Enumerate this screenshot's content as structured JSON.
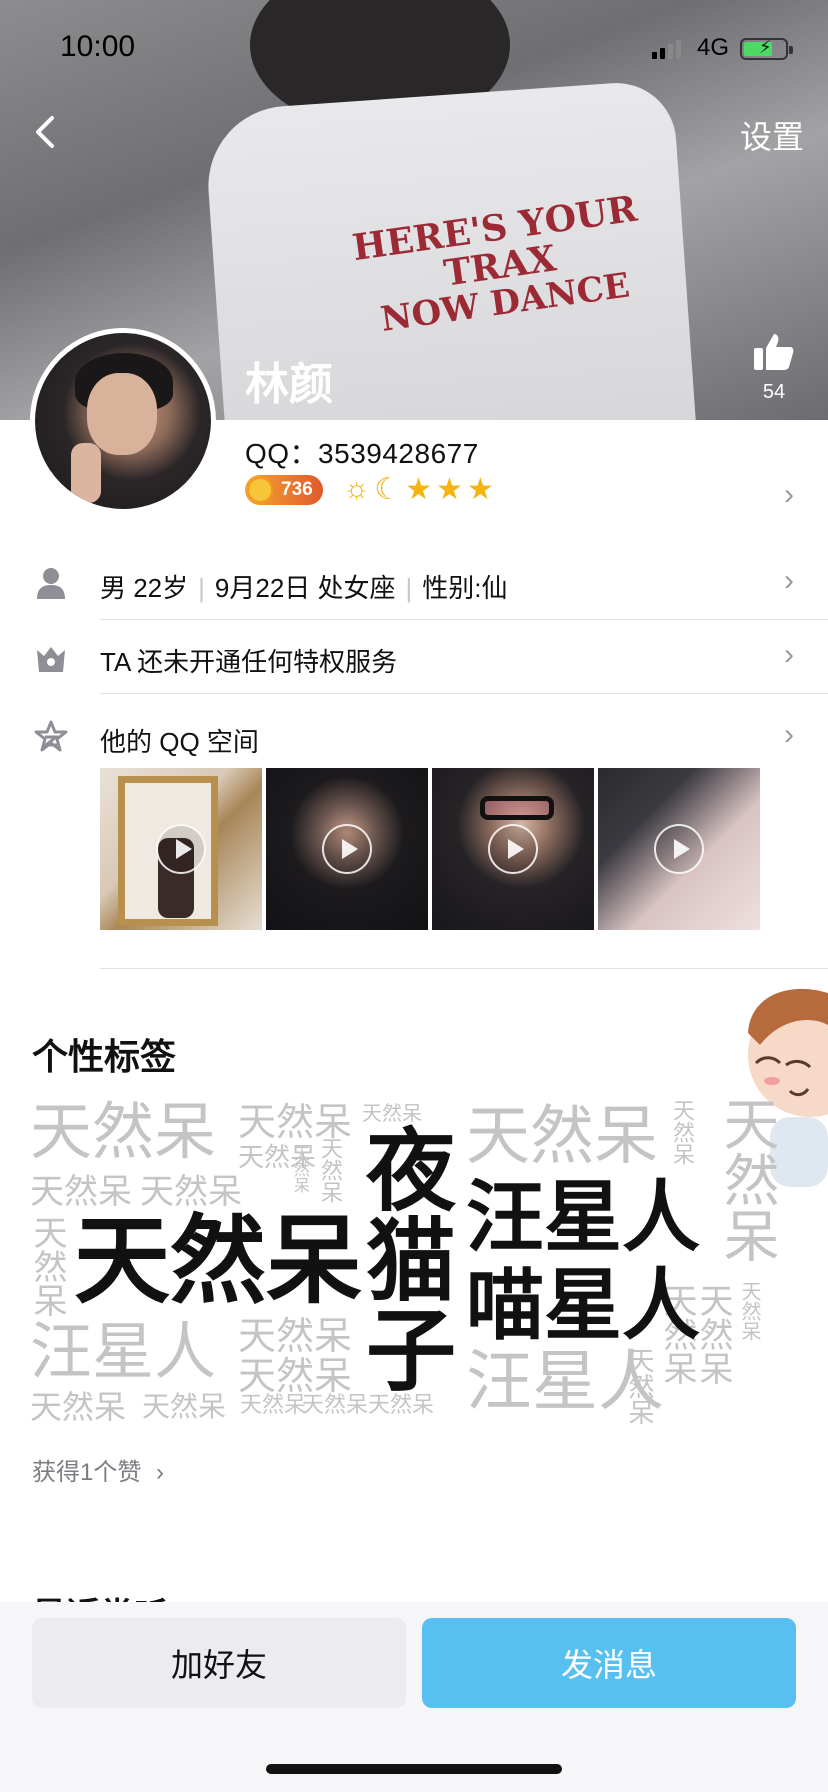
{
  "status_bar": {
    "time": "10:00",
    "network": "4G"
  },
  "header": {
    "settings_label": "设置",
    "like_count": "54"
  },
  "profile": {
    "name": "林颜",
    "qq_label": "QQ：3539428677",
    "coin_value": "736"
  },
  "info_rows": {
    "gender_age": "男 22岁",
    "birthday_sign": "9月22日 处女座",
    "custom_gender": "性别:仙",
    "privilege": "TA 还未开通任何特权服务",
    "qzone": "他的 QQ 空间"
  },
  "tags_section": {
    "title": "个性标签",
    "tags_large": [
      "天然呆",
      "夜",
      "猫",
      "子",
      "汪星人",
      "喵星人"
    ],
    "tag_background": "天然呆",
    "tag_background_2": "汪星人",
    "likes_link": "获得1个赞"
  },
  "recent_section": {
    "title": "最近常听"
  },
  "actions": {
    "add_friend": "加好友",
    "send_message": "发消息"
  },
  "colors": {
    "accent": "#57c0f0",
    "coin": "#e05a2a"
  }
}
